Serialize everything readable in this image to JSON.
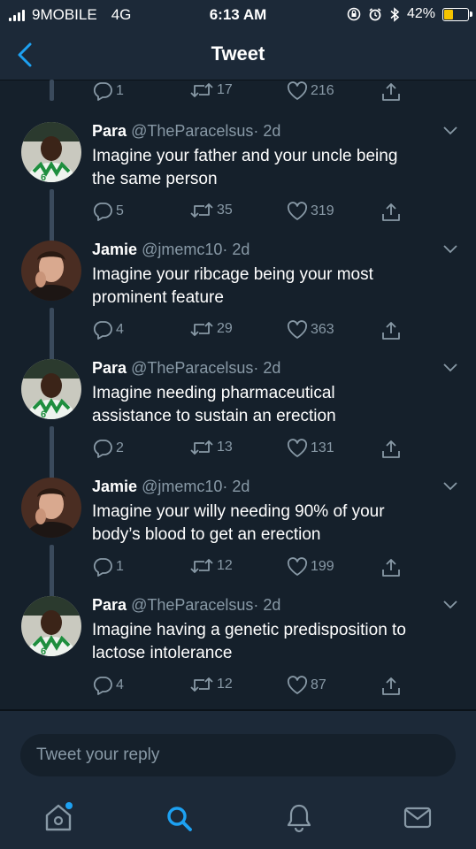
{
  "status_bar": {
    "carrier": "9MOBILE",
    "network": "4G",
    "time": "6:13 AM",
    "battery": "42%",
    "battery_level": 0.42,
    "battery_color": "#f5c400"
  },
  "nav": {
    "title": "Tweet",
    "back_icon": "chevron-left-icon"
  },
  "top_actions": {
    "replies": "1",
    "retweets": "17",
    "likes": "216"
  },
  "tweets": [
    {
      "name": "Para",
      "handle": "@TheParacelsus",
      "time": "· 2d",
      "line1": "Imagine your father and your uncle being",
      "line2": "the same person",
      "replies": "5",
      "retweets": "35",
      "likes": "319"
    },
    {
      "name": "Jamie",
      "handle": "@jmemc10",
      "time": "· 2d",
      "line1": "Imagine your ribcage being your most",
      "line2": "prominent feature",
      "replies": "4",
      "retweets": "29",
      "likes": "363"
    },
    {
      "name": "Para",
      "handle": "@TheParacelsus",
      "time": "· 2d",
      "line1": "Imagine needing pharmaceutical",
      "line2": "assistance to sustain an erection",
      "replies": "2",
      "retweets": "13",
      "likes": "131"
    },
    {
      "name": "Jamie",
      "handle": "@jmemc10",
      "time": "· 2d",
      "line1": "Imagine your willy needing 90% of your",
      "line2": "body’s blood to get an erection",
      "replies": "1",
      "retweets": "12",
      "likes": "199"
    },
    {
      "name": "Para",
      "handle": "@TheParacelsus",
      "time": "· 2d",
      "line1": "Imagine having a genetic predisposition to",
      "line2": "lactose intolerance",
      "replies": "4",
      "retweets": "12",
      "likes": "87"
    }
  ],
  "reply": {
    "placeholder": "Tweet your reply"
  },
  "tabs": [
    "home-icon",
    "search-icon",
    "notifications-icon",
    "messages-icon"
  ],
  "colors": {
    "background": "#15202b",
    "bar": "#1c2938",
    "muted": "#8899a6",
    "accent": "#1da1f2"
  }
}
